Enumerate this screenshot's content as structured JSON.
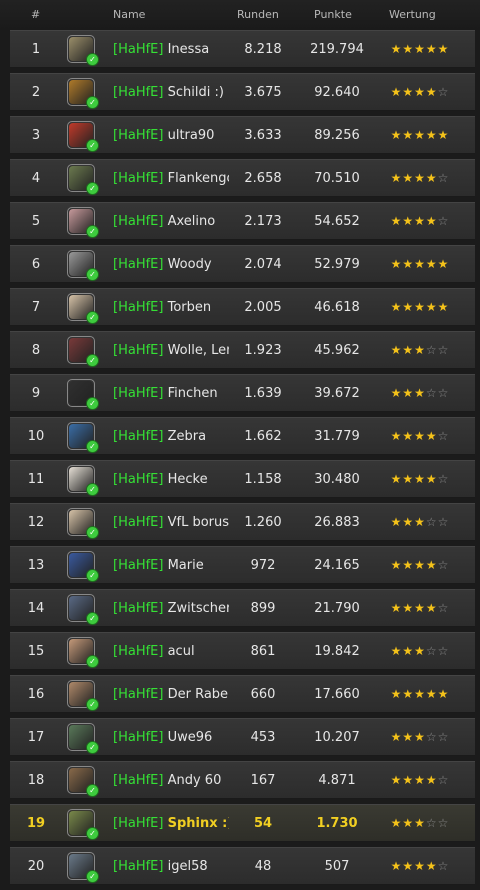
{
  "header": {
    "rank": "#",
    "name": "Name",
    "runden": "Runden",
    "punkte": "Punkte",
    "wertung": "Wertung"
  },
  "colors": {
    "tag": "#35e035",
    "highlight": "#f1cf22",
    "star_on": "#f4c21a",
    "star_off": "#8a8a8a"
  },
  "rows": [
    {
      "rank": "1",
      "tag": "[HaHfE]",
      "player": "Inessa",
      "runden": "8.218",
      "punkte": "219.794",
      "stars": 5,
      "avatar_color": "#9b8f6a",
      "highlight": false
    },
    {
      "rank": "2",
      "tag": "[HaHfE]",
      "player": "Schildi :)",
      "runden": "3.675",
      "punkte": "92.640",
      "stars": 4,
      "avatar_color": "#b07b2a",
      "highlight": false
    },
    {
      "rank": "3",
      "tag": "[HaHfE]",
      "player": "ultra90",
      "runden": "3.633",
      "punkte": "89.256",
      "stars": 5,
      "avatar_color": "#c23a2a",
      "highlight": false
    },
    {
      "rank": "4",
      "tag": "[HaHfE]",
      "player": "Flankengott",
      "runden": "2.658",
      "punkte": "70.510",
      "stars": 4,
      "avatar_color": "#6c7b4f",
      "highlight": false
    },
    {
      "rank": "5",
      "tag": "[HaHfE]",
      "player": "Axelino",
      "runden": "2.173",
      "punkte": "54.652",
      "stars": 4,
      "avatar_color": "#c79a9c",
      "highlight": false
    },
    {
      "rank": "6",
      "tag": "[HaHfE]",
      "player": "Woody",
      "runden": "2.074",
      "punkte": "52.979",
      "stars": 5,
      "avatar_color": "#9a9a9a",
      "highlight": false
    },
    {
      "rank": "7",
      "tag": "[HaHfE]",
      "player": "Torben",
      "runden": "2.005",
      "punkte": "46.618",
      "stars": 5,
      "avatar_color": "#d7c3a8",
      "highlight": false
    },
    {
      "rank": "8",
      "tag": "[HaHfE]",
      "player": "Wolle, Lens",
      "runden": "1.923",
      "punkte": "45.962",
      "stars": 3,
      "avatar_color": "#7a3a3a",
      "highlight": false
    },
    {
      "rank": "9",
      "tag": "[HaHfE]",
      "player": "Finchen",
      "runden": "1.639",
      "punkte": "39.672",
      "stars": 3,
      "avatar_color": "#303030",
      "highlight": false
    },
    {
      "rank": "10",
      "tag": "[HaHfE]",
      "player": "Zebra",
      "runden": "1.662",
      "punkte": "31.779",
      "stars": 4,
      "avatar_color": "#3a6ea8",
      "highlight": false
    },
    {
      "rank": "11",
      "tag": "[HaHfE]",
      "player": "Hecke",
      "runden": "1.158",
      "punkte": "30.480",
      "stars": 4,
      "avatar_color": "#e6e0d6",
      "highlight": false
    },
    {
      "rank": "12",
      "tag": "[HaHfE]",
      "player": "VfL borussia",
      "runden": "1.260",
      "punkte": "26.883",
      "stars": 3,
      "avatar_color": "#d7c3a8",
      "highlight": false
    },
    {
      "rank": "13",
      "tag": "[HaHfE]",
      "player": "Marie",
      "runden": "972",
      "punkte": "24.165",
      "stars": 4,
      "avatar_color": "#3a5aa0",
      "highlight": false
    },
    {
      "rank": "14",
      "tag": "[HaHfE]",
      "player": "Zwitscher",
      "runden": "899",
      "punkte": "21.790",
      "stars": 4,
      "avatar_color": "#5a6a86",
      "highlight": false
    },
    {
      "rank": "15",
      "tag": "[HaHfE]",
      "player": "acul",
      "runden": "861",
      "punkte": "19.842",
      "stars": 3,
      "avatar_color": "#c59a7a",
      "highlight": false
    },
    {
      "rank": "16",
      "tag": "[HaHfE]",
      "player": "Der Rabe",
      "runden": "660",
      "punkte": "17.660",
      "stars": 5,
      "avatar_color": "#b08a6a",
      "highlight": false
    },
    {
      "rank": "17",
      "tag": "[HaHfE]",
      "player": "Uwe96",
      "runden": "453",
      "punkte": "10.207",
      "stars": 3,
      "avatar_color": "#5a7a5a",
      "highlight": false
    },
    {
      "rank": "18",
      "tag": "[HaHfE]",
      "player": "Andy 60",
      "runden": "167",
      "punkte": "4.871",
      "stars": 4,
      "avatar_color": "#8a6a4a",
      "highlight": false
    },
    {
      "rank": "19",
      "tag": "[HaHfE]",
      "player": "Sphinx :)",
      "runden": "54",
      "punkte": "1.730",
      "stars": 3,
      "avatar_color": "#7a8a4a",
      "highlight": true
    },
    {
      "rank": "20",
      "tag": "[HaHfE]",
      "player": "igel58",
      "runden": "48",
      "punkte": "507",
      "stars": 4,
      "avatar_color": "#6a7a8a",
      "highlight": false
    }
  ]
}
